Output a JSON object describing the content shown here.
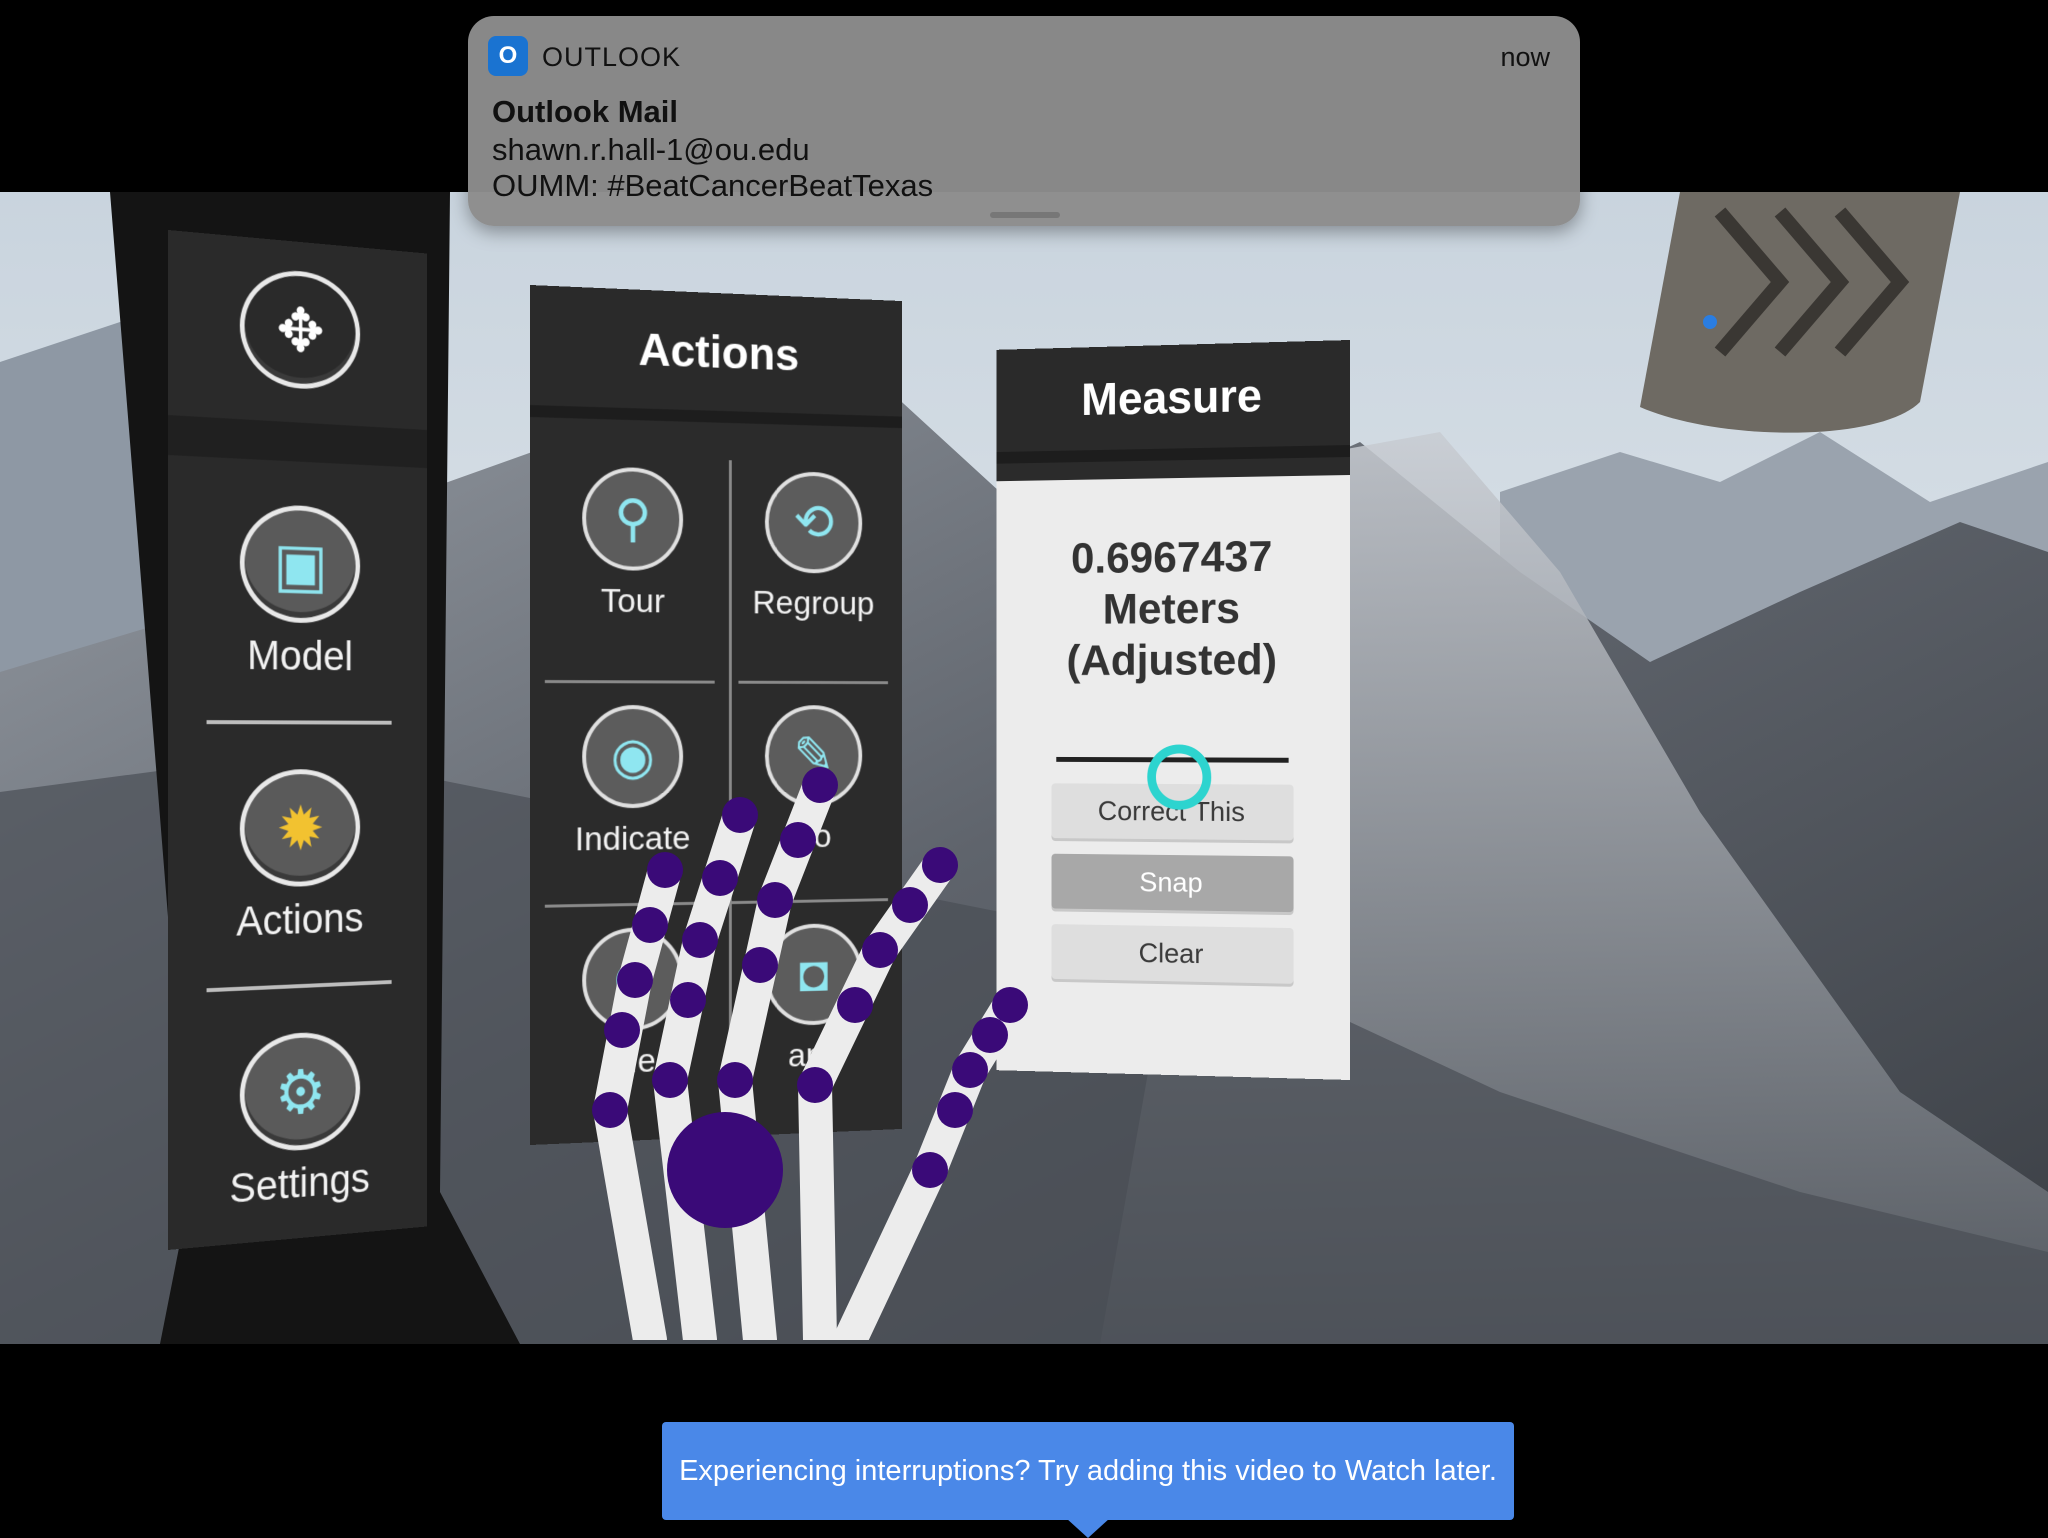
{
  "notification": {
    "app_name": "OUTLOOK",
    "app_icon": "outlook-icon",
    "time": "now",
    "title": "Outlook Mail",
    "sender": "shawn.r.hall-1@ou.edu",
    "subject": "OUMM: #BeatCancerBeatTexas"
  },
  "nav_menu": {
    "move_icon": "move-arrows-icon",
    "items": [
      {
        "label": "Model",
        "icon": "cube-icon"
      },
      {
        "label": "Actions",
        "icon": "gear-sun-icon"
      },
      {
        "label": "Settings",
        "icon": "settings-gear-icon"
      }
    ]
  },
  "actions_panel": {
    "title": "Actions",
    "items": [
      {
        "label": "Tour",
        "icon": "location-pin-icon"
      },
      {
        "label": "Regroup",
        "icon": "regroup-icon"
      },
      {
        "label": "Indicate",
        "icon": "indicate-icon"
      },
      {
        "label": "no",
        "icon": "pencil-icon"
      },
      {
        "label": "Me",
        "icon": "measure-icon"
      },
      {
        "label": "aps",
        "icon": "camera-icon"
      }
    ]
  },
  "measure_panel": {
    "title": "Measure",
    "value": "0.6967437",
    "unit": "Meters",
    "note": "(Adjusted)",
    "buttons": {
      "correct": "Correct This",
      "snap": "Snap",
      "clear": "Clear"
    }
  },
  "toast": {
    "message": "Experiencing interruptions? Try adding this video to Watch later."
  },
  "colors": {
    "hand_joint": "#3a0a78",
    "toast_bg": "#4a88e8",
    "cursor_ring": "#2dd4cf",
    "icon_accent": "#8fe6f0"
  }
}
